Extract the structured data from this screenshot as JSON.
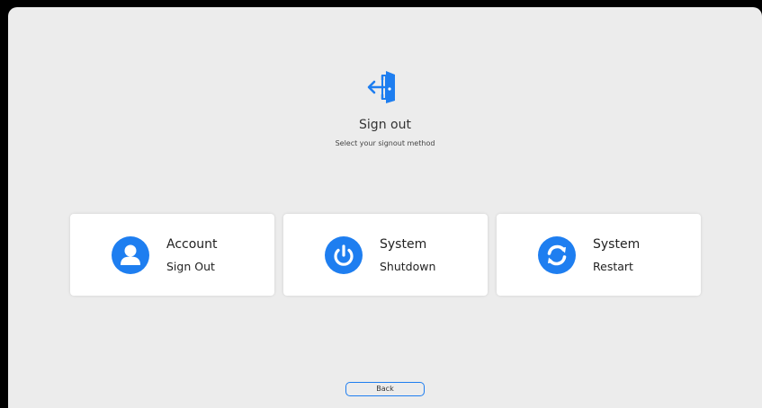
{
  "header": {
    "icon": "sign-out-door-icon",
    "title": "Sign out",
    "subtitle": "Select your signout method"
  },
  "options": [
    {
      "icon": "user-icon",
      "line1": "Account",
      "line2": "Sign Out"
    },
    {
      "icon": "power-icon",
      "line1": "System",
      "line2": "Shutdown"
    },
    {
      "icon": "restart-icon",
      "line1": "System",
      "line2": "Restart"
    }
  ],
  "footer": {
    "back_label": "Back"
  },
  "colors": {
    "accent": "#1e7ef0",
    "background": "#ececec",
    "card": "#ffffff"
  }
}
